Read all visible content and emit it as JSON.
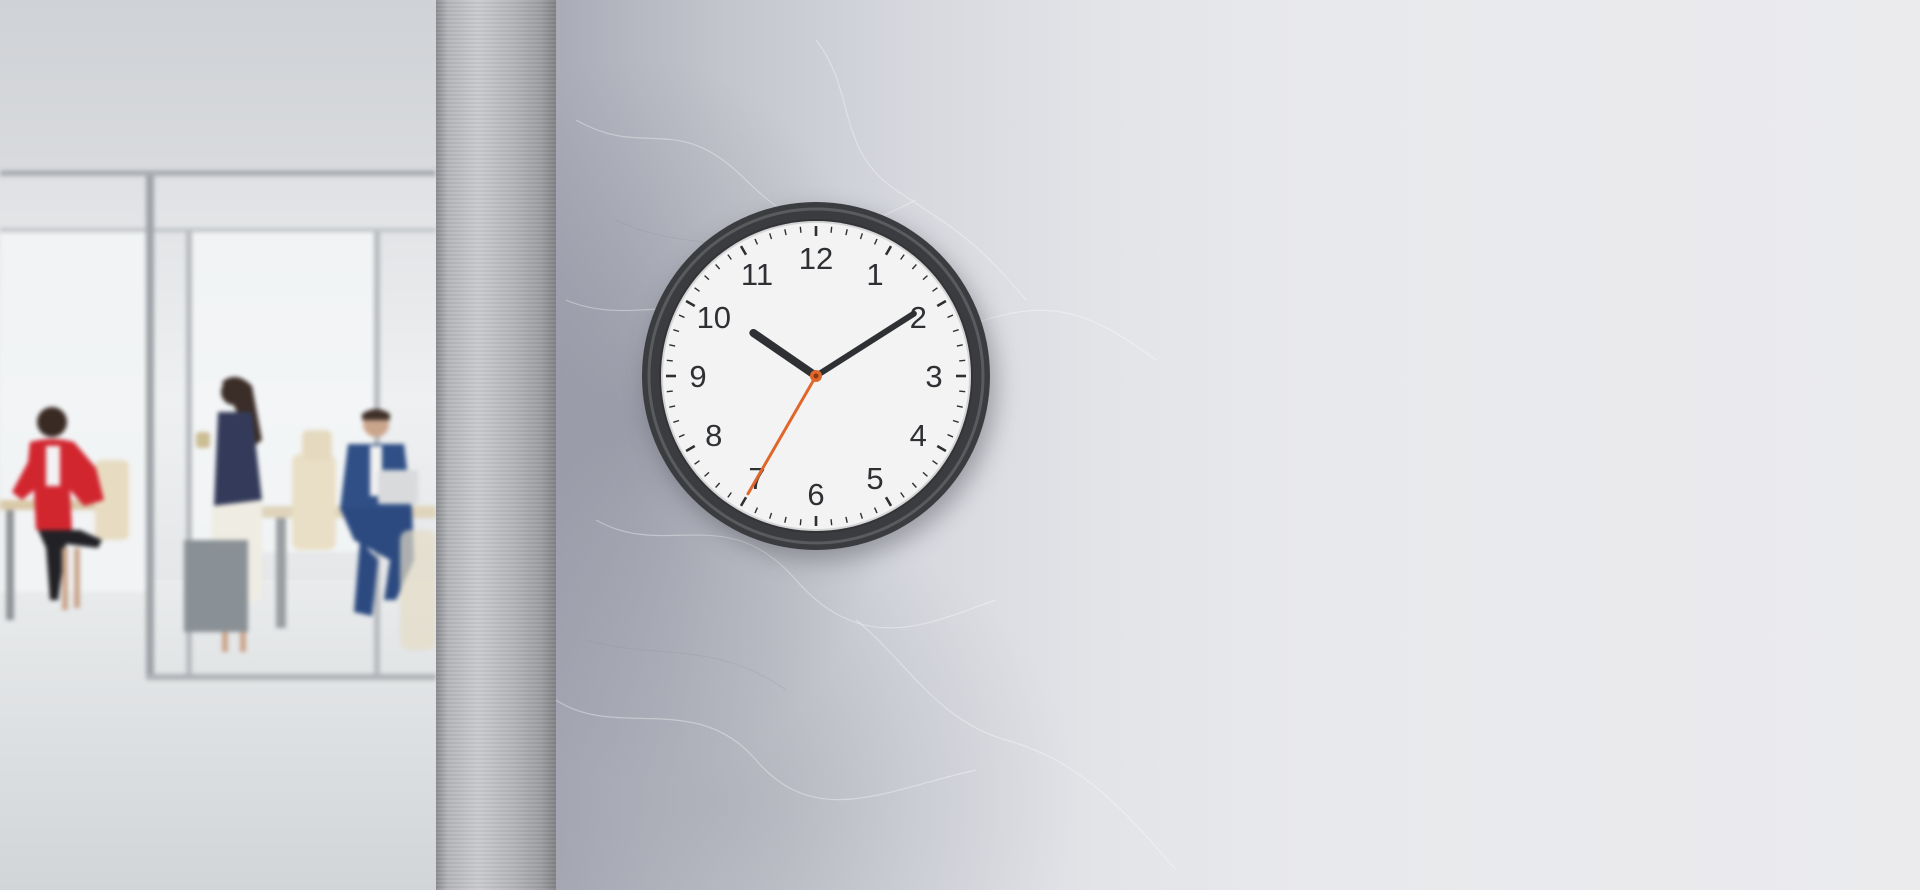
{
  "clock": {
    "numerals": [
      "12",
      "1",
      "2",
      "3",
      "4",
      "5",
      "6",
      "7",
      "8",
      "9",
      "10",
      "11"
    ],
    "time": {
      "hours": 10,
      "minutes": 9,
      "seconds": 35
    },
    "colors": {
      "case": "#3b3c3f",
      "face": "#f3f3f3",
      "hands": "#2e3033",
      "second_hand": "#e0662a"
    }
  }
}
